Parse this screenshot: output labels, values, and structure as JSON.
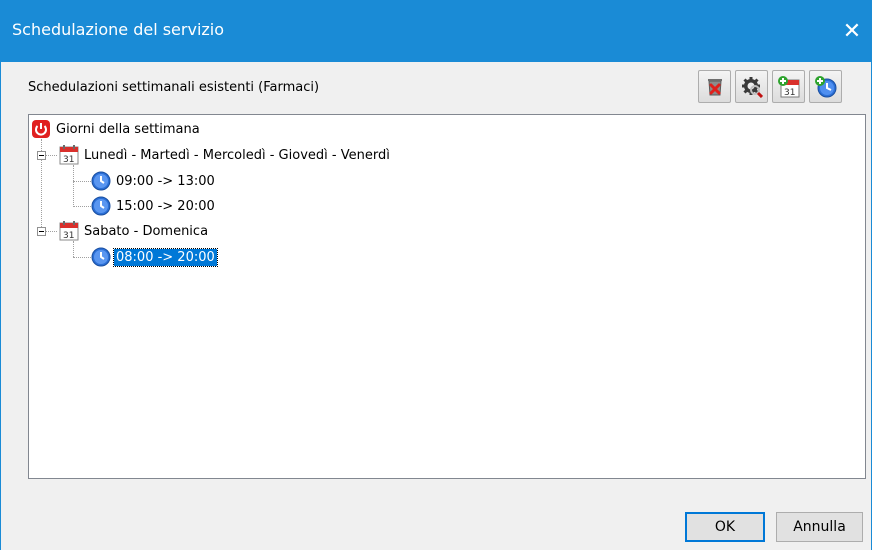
{
  "window": {
    "title": "Schedulazione del servizio",
    "close_glyph": "✕"
  },
  "header": {
    "label": "Schedulazioni settimanali esistenti (Farmaci)"
  },
  "toolbar": {
    "buttons": [
      {
        "icon": "delete-icon"
      },
      {
        "icon": "settings-search-icon"
      },
      {
        "icon": "add-calendar-icon"
      },
      {
        "icon": "add-clock-icon"
      }
    ]
  },
  "tree": {
    "root": {
      "label": "Giorni della settimana",
      "icon": "power-icon"
    },
    "groups": [
      {
        "label": "Lunedì - Martedì - Mercoledì - Giovedì - Venerdì",
        "icon": "calendar-icon",
        "ranges": [
          "09:00 -> 13:00",
          "15:00 -> 20:00"
        ]
      },
      {
        "label": "Sabato - Domenica",
        "icon": "calendar-icon",
        "ranges": [
          "08:00 -> 20:00"
        ]
      }
    ],
    "selected": "08:00 -> 20:00"
  },
  "buttons": {
    "ok": "OK",
    "cancel": "Annulla"
  },
  "colors": {
    "titlebar": "#1a8bd6",
    "selection": "#0078d7",
    "calendar_red": "#d9302c",
    "clock_blue": "#2b6fd6"
  }
}
